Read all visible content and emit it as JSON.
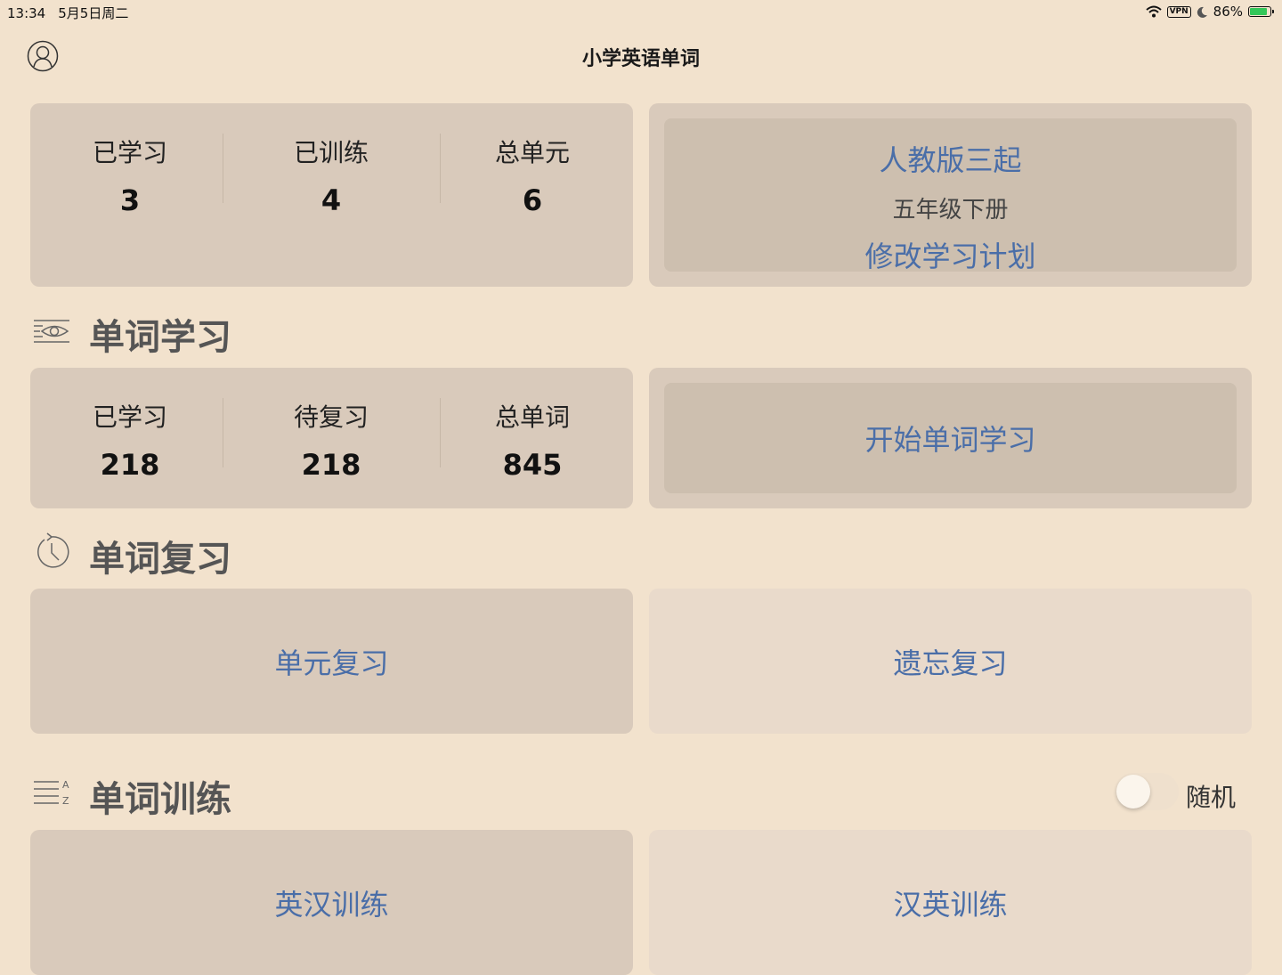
{
  "status_bar": {
    "time": "13:34",
    "date": "5月5日周二",
    "vpn": "VPN",
    "battery": "86%",
    "battery_level": 0.86
  },
  "nav": {
    "title": "小学英语单词"
  },
  "overview": {
    "stats": [
      {
        "label": "已学习",
        "value": "3"
      },
      {
        "label": "已训练",
        "value": "4"
      },
      {
        "label": "总单元",
        "value": "6"
      }
    ],
    "plan": {
      "textbook": "人教版三起",
      "grade": "五年级下册",
      "edit_label": "修改学习计划"
    }
  },
  "study": {
    "title": "单词学习",
    "icon": "eye-icon",
    "stats": [
      {
        "label": "已学习",
        "value": "218"
      },
      {
        "label": "待复习",
        "value": "218"
      },
      {
        "label": "总单词",
        "value": "845"
      }
    ],
    "start_label": "开始单词学习"
  },
  "review": {
    "title": "单词复习",
    "icon": "clock-icon",
    "unit_review_label": "单元复习",
    "forget_review_label": "遗忘复习"
  },
  "training": {
    "title": "单词训练",
    "icon": "sort-az-icon",
    "random_label": "随机",
    "random_on": false,
    "en_cn_label": "英汉训练",
    "cn_en_label": "汉英训练"
  },
  "colors": {
    "background": "#f2e2cd",
    "card": "#d9cabb",
    "card_light": "#e9dacb",
    "accent_blue": "#4a6ea8"
  }
}
